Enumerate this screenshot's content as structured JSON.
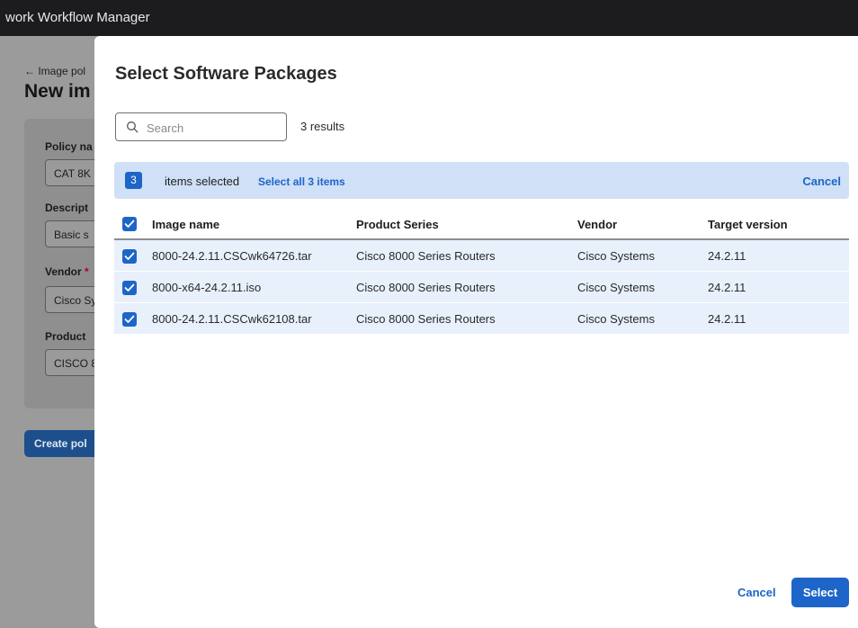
{
  "app": {
    "title": "work Workflow Manager"
  },
  "background_page": {
    "back_link": "← Image pol",
    "title": "New im",
    "fields": [
      {
        "label": "Policy na",
        "value": "CAT 8K",
        "required": false
      },
      {
        "label": "Descript",
        "value": "Basic s",
        "required": false
      },
      {
        "label": "Vendor",
        "value": "Cisco Sy",
        "required": true
      },
      {
        "label": "Product",
        "value": "CISCO 8",
        "required": false
      }
    ],
    "required_mark": "*",
    "create_button": "Create pol"
  },
  "modal": {
    "title": "Select Software Packages",
    "search": {
      "placeholder": "Search",
      "value": ""
    },
    "results": "3 results",
    "selection_bar": {
      "count": "3",
      "items_selected": "items selected",
      "select_all": "Select all 3 items",
      "cancel": "Cancel"
    },
    "table": {
      "columns": [
        "Image name",
        "Product Series",
        "Vendor",
        "Target version"
      ],
      "rows": [
        {
          "image": "8000-24.2.11.CSCwk64726.tar",
          "series": "Cisco 8000 Series Routers",
          "vendor": "Cisco Systems",
          "version": "24.2.11",
          "checked": true
        },
        {
          "image": "8000-x64-24.2.11.iso",
          "series": "Cisco 8000 Series Routers",
          "vendor": "Cisco Systems",
          "version": "24.2.11",
          "checked": true
        },
        {
          "image": "8000-24.2.11.CSCwk62108.tar",
          "series": "Cisco 8000 Series Routers",
          "vendor": "Cisco Systems",
          "version": "24.2.11",
          "checked": true
        }
      ]
    },
    "footer": {
      "cancel": "Cancel",
      "select": "Select"
    }
  },
  "colors": {
    "accent": "#1d65c8",
    "selection_bg": "#cfe0f7",
    "row_bg": "#e8f0fc",
    "topbar": "#1c1c1e"
  }
}
